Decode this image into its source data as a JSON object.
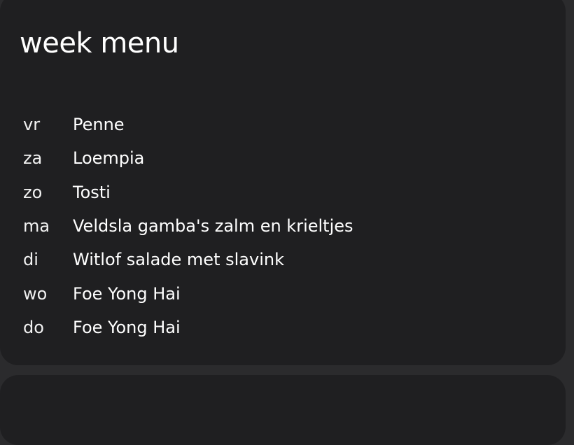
{
  "week_menu": {
    "title": "week menu",
    "rows": [
      {
        "day": "vr",
        "dish": "Penne"
      },
      {
        "day": "za",
        "dish": "Loempia"
      },
      {
        "day": "zo",
        "dish": "Tosti"
      },
      {
        "day": "ma",
        "dish": "Veldsla gamba's zalm en krieltjes"
      },
      {
        "day": "di",
        "dish": "Witlof salade met slavink"
      },
      {
        "day": "wo",
        "dish": "Foe Yong Hai"
      },
      {
        "day": "do",
        "dish": "Foe Yong Hai"
      }
    ]
  },
  "colors": {
    "page_background": "#2b2b2d",
    "card_background": "#1f1f21",
    "text": "#ffffff"
  }
}
